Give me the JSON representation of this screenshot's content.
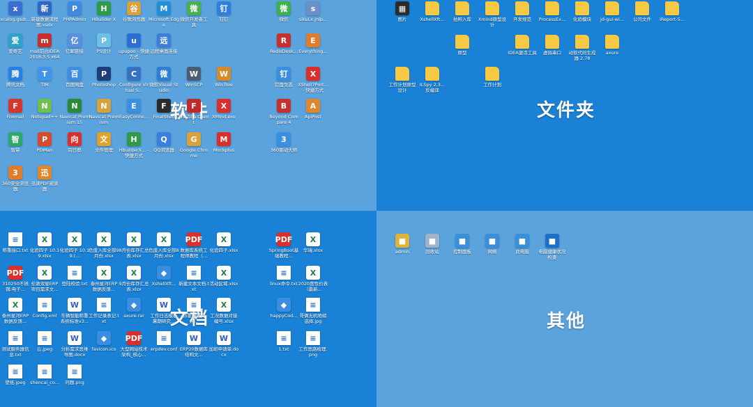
{
  "quadrants": {
    "software": {
      "label": "软件"
    },
    "folders": {
      "label": "文件夹"
    },
    "documents": {
      "label": "文档"
    },
    "others": {
      "label": "其他"
    }
  },
  "software_icons": [
    {
      "label": "xcalog.gsdr...",
      "icon": "app-icon",
      "color": "#3a6fd0"
    },
    {
      "label": "新建数据流程图.vsdx",
      "icon": "visio-icon",
      "color": "#2f66c7"
    },
    {
      "label": "PHPAdmin",
      "icon": "app-icon",
      "color": "#3f89de"
    },
    {
      "label": "HBuilder X",
      "icon": "hbuilder-icon",
      "color": "#2e9b49"
    },
    {
      "label": "谷歌浏览器",
      "icon": "chrome-icon",
      "color": "#d9a13d"
    },
    {
      "label": "Microsoft Edge",
      "icon": "edge-icon",
      "color": "#1f8fd8"
    },
    {
      "label": "微信开发者工具",
      "icon": "wechat-dev-icon",
      "color": "#48b04f"
    },
    {
      "label": "钉钉",
      "icon": "dingtalk-icon",
      "color": "#2d7fe0"
    },
    {
      "label": "爱奇艺",
      "icon": "app-icon",
      "color": "#2ea3c8"
    },
    {
      "label": "mall前台IDEA 2018.3.5 x64",
      "icon": "idea-icon",
      "color": "#c8302d"
    },
    {
      "label": "亿邮链接",
      "icon": "app-icon",
      "color": "#5a8fe0"
    },
    {
      "label": "PS设计",
      "icon": "app-icon",
      "color": "#6ec0e8"
    },
    {
      "label": "upupoo - 快捷方式",
      "icon": "app-icon",
      "color": "#2c6fd4"
    },
    {
      "label": "远程桌面连接",
      "icon": "remote-desktop-icon",
      "color": "#3c7fd8"
    },
    {
      "label": "腾讯文档",
      "icon": "app-icon",
      "color": "#2680e6"
    },
    {
      "label": "TIM",
      "icon": "tim-icon",
      "color": "#3f95e8"
    },
    {
      "label": "百度网盘",
      "icon": "app-icon",
      "color": "#3f8ee6"
    },
    {
      "label": "Photoshop",
      "icon": "photoshop-icon",
      "color": "#1e3d7a"
    },
    {
      "label": "Configure Virtual S...",
      "icon": "app-icon",
      "color": "#3573c2"
    },
    {
      "label": "微软Visual Studio",
      "icon": "app-icon",
      "color": "#2d7fd6"
    },
    {
      "label": "WinSCP",
      "icon": "winscp-icon",
      "color": "#4a5d73"
    },
    {
      "label": "WinTree",
      "icon": "app-icon",
      "color": "#d68a2a"
    },
    {
      "label": "Foxmail",
      "icon": "foxmail-icon",
      "color": "#d4382c"
    },
    {
      "label": "Notepad++",
      "icon": "notepad-icon",
      "color": "#6fbf4f"
    },
    {
      "label": "Navicat Premium 15",
      "icon": "navicat-icon",
      "color": "#2a8a3a"
    },
    {
      "label": "Navicat Premium",
      "icon": "navicat-icon",
      "color": "#d9a13d"
    },
    {
      "label": "EasyConne...",
      "icon": "app-icon",
      "color": "#3a8fde"
    },
    {
      "label": "FinalShell",
      "icon": "app-icon",
      "color": "#2b2b2b"
    },
    {
      "label": "FileZilla Client",
      "icon": "filezilla-icon",
      "color": "#bf2a2a"
    },
    {
      "label": "XMind.exe",
      "icon": "xmind-icon",
      "color": "#d9302c"
    },
    {
      "label": "智慧",
      "icon": "app-icon",
      "color": "#2fa96b"
    },
    {
      "label": "PDMan",
      "icon": "app-icon",
      "color": "#d94a2c"
    },
    {
      "label": "向日葵",
      "icon": "app-icon",
      "color": "#d9302c"
    },
    {
      "label": "文件管理",
      "icon": "app-icon",
      "color": "#e0a22c"
    },
    {
      "label": "HBuilderX... - 快捷方式",
      "icon": "hbuilder-icon",
      "color": "#2e9b49"
    },
    {
      "label": "QQ浏览器",
      "icon": "app-icon",
      "color": "#3a7fe0"
    },
    {
      "label": "Google Chrome",
      "icon": "chrome-icon",
      "color": "#d9a13d"
    },
    {
      "label": "Mockplus",
      "icon": "app-icon",
      "color": "#d9302c"
    },
    {
      "label": "360安全浏览器",
      "icon": "app-icon",
      "color": "#e07d2c"
    },
    {
      "label": "迅读PDF阅读器",
      "icon": "app-icon",
      "color": "#e0862c"
    },
    {
      "label": "微信",
      "icon": "wechat-icon",
      "color": "#3bb24a"
    },
    {
      "label": "sikuLx.jnlp...",
      "icon": "app-icon",
      "color": "#6c8fc7"
    },
    {
      "label": "RedisDesk...",
      "icon": "redis-icon",
      "color": "#c8302d"
    },
    {
      "label": "Everything...",
      "icon": "everything-icon",
      "color": "#e07d2c"
    },
    {
      "label": "钉盘生态",
      "icon": "app-icon",
      "color": "#3a8fde"
    },
    {
      "label": "XShell7Port... - 快捷方式",
      "icon": "xshell-icon",
      "color": "#d9302c"
    },
    {
      "label": "Beyond Compare 4",
      "icon": "beyond-compare-icon",
      "color": "#c8302d"
    },
    {
      "label": "ApiPost",
      "icon": "apipost-icon",
      "color": "#e0862c"
    },
    {
      "label": "360驱动大师",
      "icon": "app-icon",
      "color": "#3a8fde"
    }
  ],
  "folder_icons": [
    {
      "label": "图片",
      "icon": "image-folder-icon"
    },
    {
      "label": "XshellXft...",
      "icon": "folder-icon"
    },
    {
      "label": "拍照入库",
      "icon": "folder-icon"
    },
    {
      "label": "Xmind原型设计",
      "icon": "folder-icon"
    },
    {
      "label": "开发规范",
      "icon": "folder-icon"
    },
    {
      "label": "ProcessEx...",
      "icon": "folder-icon"
    },
    {
      "label": "化验模块",
      "icon": "folder-icon"
    },
    {
      "label": "jd-gui-wi...",
      "icon": "folder-icon"
    },
    {
      "label": "公司文件",
      "icon": "folder-icon"
    },
    {
      "label": "iReport-5...",
      "icon": "folder-icon"
    },
    {
      "label": "原型",
      "icon": "folder-icon"
    },
    {
      "label": "IDEA激活工具",
      "icon": "folder-icon"
    },
    {
      "label": "虚拟串口",
      "icon": "folder-icon"
    },
    {
      "label": "动软代码生成器 2.78",
      "icon": "folder-icon"
    },
    {
      "label": "axure",
      "icon": "folder-icon"
    },
    {
      "label": "工作计划原型设计",
      "icon": "folder-icon"
    },
    {
      "label": "ILSpy 2.3... 反编译",
      "icon": "folder-icon"
    },
    {
      "label": "工作计划",
      "icon": "folder-icon"
    }
  ],
  "document_icons": [
    {
      "label": "称重接口.txt",
      "type": "file"
    },
    {
      "label": "化验四子 10.19.xlsx",
      "type": "xls"
    },
    {
      "label": "化验四子 10.19.(...",
      "type": "xls"
    },
    {
      "label": "危废入库全部9月份.xlsx",
      "type": "xls"
    },
    {
      "label": "8月份库存汇总表.xlsx",
      "type": "xls"
    },
    {
      "label": "危废入库全部8月份.xlsx",
      "type": "xls"
    },
    {
      "label": "数据库系统工程师教程（...",
      "type": "pdf"
    },
    {
      "label": "化验四子.xlsx",
      "type": "xls"
    },
    {
      "label": "SpringBoot基础教程...",
      "type": "pdf"
    },
    {
      "label": "华瑞.xlsx",
      "type": "xls"
    },
    {
      "label": "310250不锈钢.电子...",
      "type": "pdf"
    },
    {
      "label": "伦敦双星ERP项目需求文...",
      "type": "xls"
    },
    {
      "label": "登陆校验.txt",
      "type": "file"
    },
    {
      "label": "泰州星河ERP数据反馈...",
      "type": "xls"
    },
    {
      "label": "9月份库存汇总表.xlsx",
      "type": "xls"
    },
    {
      "label": "XshellXft...",
      "type": "app"
    },
    {
      "label": "新建文本文档.txt",
      "type": "file"
    },
    {
      "label": "活动区域.xlsx",
      "type": "xls"
    },
    {
      "label": "linux命令.txt",
      "type": "file"
    },
    {
      "label": "2020度性价表（最新...",
      "type": "xls"
    },
    {
      "label": "泰州星河ERP数据反馈...",
      "type": "xls"
    },
    {
      "label": "Config.xml",
      "type": "file"
    },
    {
      "label": "车辆智能称重系统标准v3...",
      "type": "doc"
    },
    {
      "label": "工作记录表记.txt",
      "type": "file"
    },
    {
      "label": "axure.rar",
      "type": "app"
    },
    {
      "label": "工作日志模板暑期研究...",
      "type": "doc"
    },
    {
      "label": "称重配置文件...",
      "type": "file"
    },
    {
      "label": "工况数据对接编号.xlsx",
      "type": "xls"
    },
    {
      "label": "happyCod...",
      "type": "app"
    },
    {
      "label": "哥俩无机地磅选择.jpg",
      "type": "file"
    },
    {
      "label": "测试服务器信息.txt",
      "type": "file"
    },
    {
      "label": "云.jpeg",
      "type": "file"
    },
    {
      "label": "分析需求思维导图.docx",
      "type": "doc"
    },
    {
      "label": "favicon.ico",
      "type": "app"
    },
    {
      "label": "大型网站技术架构_核心...",
      "type": "pdf"
    },
    {
      "label": "erpdev.conf",
      "type": "file"
    },
    {
      "label": "ERP20数据库结构文...",
      "type": "doc"
    },
    {
      "label": "加班申请单.docx",
      "type": "doc"
    },
    {
      "label": "1.txt",
      "type": "file"
    },
    {
      "label": "工作思路梳理.png",
      "type": "file"
    },
    {
      "label": "壁纸.jpeg",
      "type": "file"
    },
    {
      "label": "shencai_co...",
      "type": "file"
    },
    {
      "label": "问题.png",
      "type": "file"
    }
  ],
  "other_icons": [
    {
      "label": "admin",
      "icon": "user-folder-icon",
      "color": "#e0b23c"
    },
    {
      "label": "回收站",
      "icon": "recycle-bin-icon",
      "color": "#9fb3c8"
    },
    {
      "label": "控制面板",
      "icon": "control-panel-icon",
      "color": "#3b8fd8"
    },
    {
      "label": "网络",
      "icon": "network-icon",
      "color": "#3b8fd8"
    },
    {
      "label": "此电脑",
      "icon": "computer-icon",
      "color": "#3b8fd8"
    },
    {
      "label": "电脑健康状况检查",
      "icon": "health-check-icon",
      "color": "#1e6fc7"
    }
  ]
}
